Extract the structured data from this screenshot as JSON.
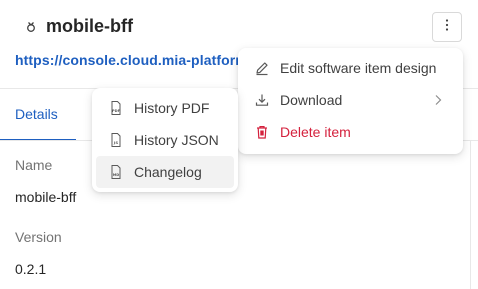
{
  "header": {
    "title": "mobile-bff",
    "link": "https://console.cloud.mia-platform.eu/"
  },
  "tabs": [
    {
      "label": "Details"
    }
  ],
  "details": {
    "name_label": "Name",
    "name_value": "mobile-bff",
    "version_label": "Version",
    "version_value": "0.2.1"
  },
  "main_menu": {
    "items": [
      {
        "label": "Edit software item design",
        "icon": "edit-icon"
      },
      {
        "label": "Download",
        "icon": "download-icon",
        "has_submenu": true
      },
      {
        "label": "Delete item",
        "icon": "trash-icon",
        "danger": true
      }
    ]
  },
  "download_menu": {
    "items": [
      {
        "label": "History PDF",
        "icon": "pdf-file-icon",
        "badge": "PDF"
      },
      {
        "label": "History JSON",
        "icon": "json-file-icon",
        "badge": "JS"
      },
      {
        "label": "Changelog",
        "icon": "markdown-file-icon",
        "badge": "MD"
      }
    ],
    "highlighted": "Changelog"
  },
  "colors": {
    "accent": "#1e5fc0",
    "danger": "#d4213d",
    "muted_text": "#737373"
  }
}
